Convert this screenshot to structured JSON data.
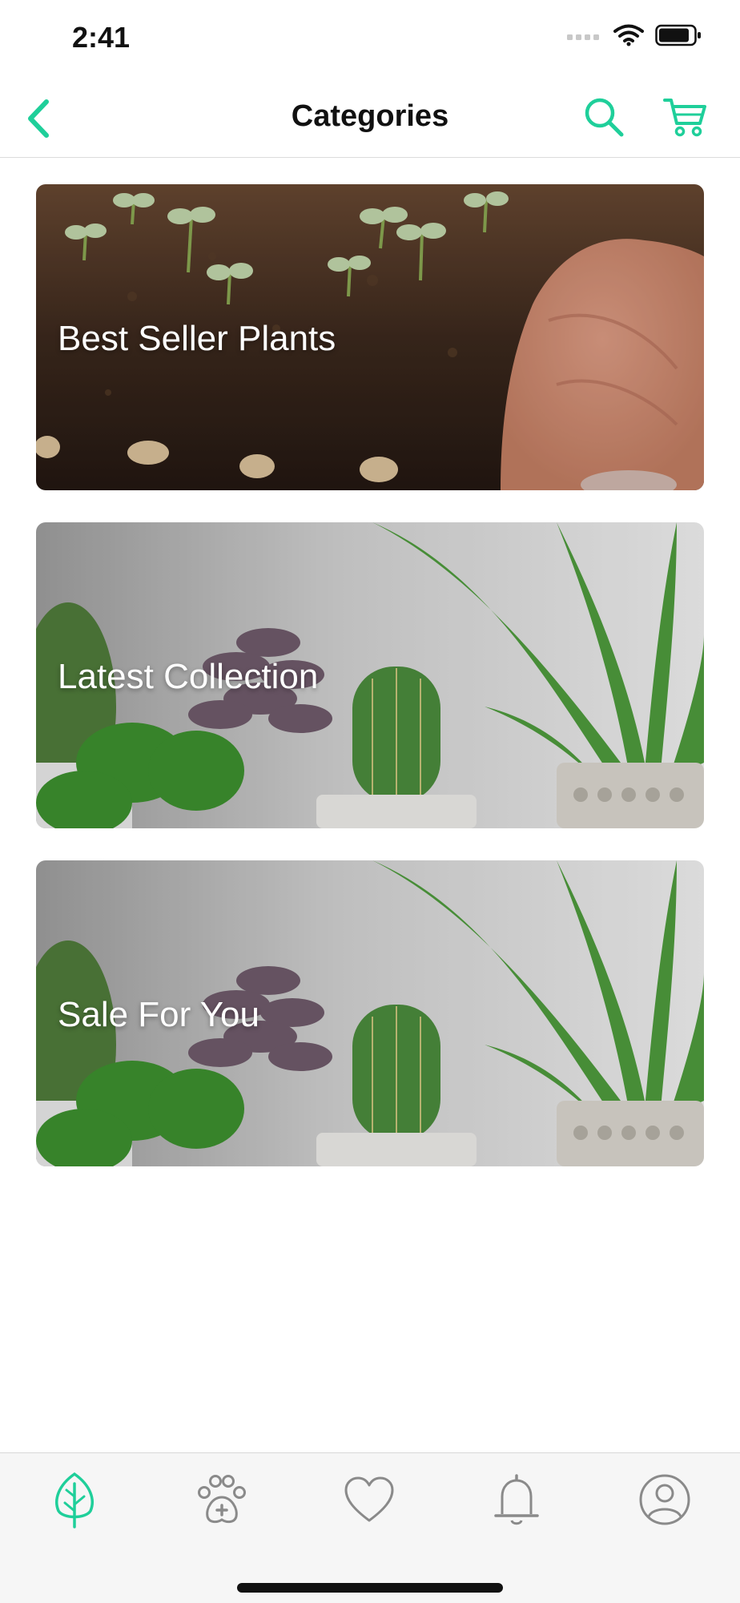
{
  "status_bar": {
    "time": "2:41"
  },
  "nav": {
    "title": "Categories"
  },
  "categories": [
    {
      "label": "Best Seller Plants"
    },
    {
      "label": "Latest Collection"
    },
    {
      "label": "Sale For You"
    }
  ],
  "tab_bar": {
    "active_tab": "plants",
    "tabs": [
      "leaf-icon",
      "paw-care-icon",
      "heart-icon",
      "bell-icon",
      "profile-icon"
    ]
  },
  "colors": {
    "accent": "#1fcf9a",
    "icon_gray": "#8a8a8a"
  }
}
